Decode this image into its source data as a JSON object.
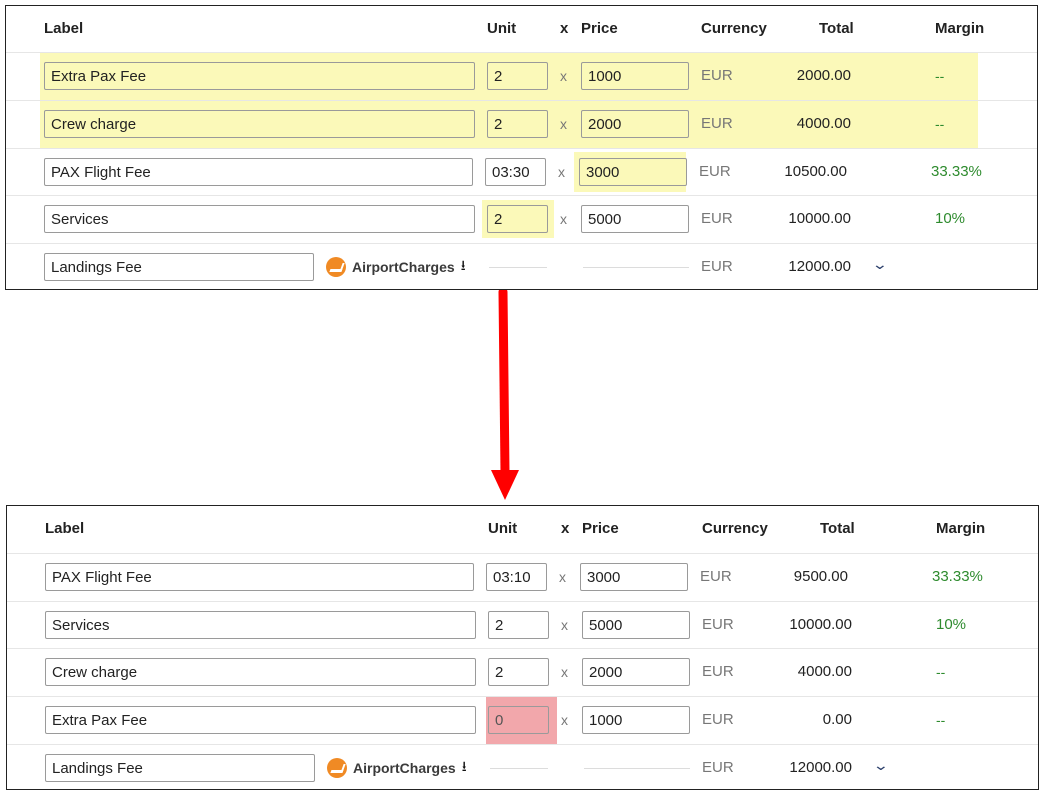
{
  "colors": {
    "highlight": "#fbf9b9",
    "error": "#f2a7ab",
    "margin_green": "#2e8b2e",
    "arrow": "#ff0000",
    "logo_orange": "#f08a24"
  },
  "headers": {
    "label": "Label",
    "unit": "Unit",
    "x": "x",
    "price": "Price",
    "currency": "Currency",
    "total": "Total",
    "margin": "Margin"
  },
  "multiply_sign": "x",
  "airport_charges": {
    "text": "AirportCharges",
    "icon": "download-icon"
  },
  "before": {
    "rows": [
      {
        "label": "Extra Pax Fee",
        "unit": "2",
        "price": "1000",
        "currency": "EUR",
        "total": "2000.00",
        "margin": "--"
      },
      {
        "label": "Crew charge",
        "unit": "2",
        "price": "2000",
        "currency": "EUR",
        "total": "4000.00",
        "margin": "--"
      },
      {
        "label": "PAX Flight Fee",
        "unit": "03:30",
        "price": "3000",
        "currency": "EUR",
        "total": "10500.00",
        "margin": "33.33%"
      },
      {
        "label": "Services",
        "unit": "2",
        "price": "5000",
        "currency": "EUR",
        "total": "10000.00",
        "margin": "10%"
      },
      {
        "label": "Landings Fee",
        "currency": "EUR",
        "total": "12000.00"
      }
    ]
  },
  "after": {
    "rows": [
      {
        "label": "PAX Flight Fee",
        "unit": "03:10",
        "price": "3000",
        "currency": "EUR",
        "total": "9500.00",
        "margin": "33.33%"
      },
      {
        "label": "Services",
        "unit": "2",
        "price": "5000",
        "currency": "EUR",
        "total": "10000.00",
        "margin": "10%"
      },
      {
        "label": "Crew charge",
        "unit": "2",
        "price": "2000",
        "currency": "EUR",
        "total": "4000.00",
        "margin": "--"
      },
      {
        "label": "Extra Pax Fee",
        "unit": "0",
        "price": "1000",
        "currency": "EUR",
        "total": "0.00",
        "margin": "--"
      },
      {
        "label": "Landings Fee",
        "currency": "EUR",
        "total": "12000.00"
      }
    ]
  }
}
